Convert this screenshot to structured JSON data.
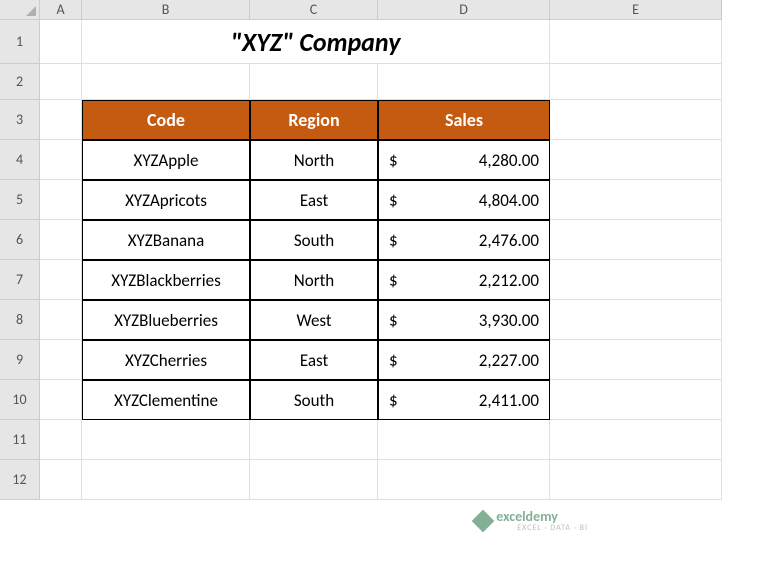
{
  "columns": [
    "A",
    "B",
    "C",
    "D",
    "E"
  ],
  "rows": [
    "1",
    "2",
    "3",
    "4",
    "5",
    "6",
    "7",
    "8",
    "9",
    "10",
    "11",
    "12"
  ],
  "title": "\"XYZ\" Company",
  "headers": {
    "code": "Code",
    "region": "Region",
    "sales": "Sales"
  },
  "currency": "$",
  "data": [
    {
      "code": "XYZApple",
      "region": "North",
      "sales": "4,280.00"
    },
    {
      "code": "XYZApricots",
      "region": "East",
      "sales": "4,804.00"
    },
    {
      "code": "XYZBanana",
      "region": "South",
      "sales": "2,476.00"
    },
    {
      "code": "XYZBlackberries",
      "region": "North",
      "sales": "2,212.00"
    },
    {
      "code": "XYZBlueberries",
      "region": "West",
      "sales": "3,930.00"
    },
    {
      "code": "XYZCherries",
      "region": "East",
      "sales": "2,227.00"
    },
    {
      "code": "XYZClementine",
      "region": "South",
      "sales": "2,411.00"
    }
  ],
  "watermark": {
    "brand": "exceldemy",
    "tagline": "EXCEL · DATA · BI"
  }
}
